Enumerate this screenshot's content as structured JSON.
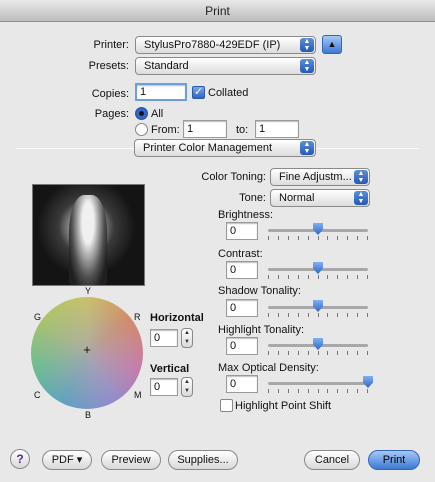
{
  "window": {
    "title": "Print"
  },
  "printer": {
    "label": "Printer:",
    "value": "StylusPro7880-429EDF (IP)"
  },
  "presets": {
    "label": "Presets:",
    "value": "Standard"
  },
  "copies": {
    "label": "Copies:",
    "value": "1",
    "collated_label": "Collated",
    "collated": true
  },
  "pages": {
    "label": "Pages:",
    "all_label": "All",
    "from_label": "From:",
    "to_label": "to:",
    "from_value": "1",
    "to_value": "1"
  },
  "section": {
    "value": "Printer Color Management"
  },
  "color_toning": {
    "label": "Color Toning:",
    "value": "Fine Adjustm..."
  },
  "tone": {
    "label": "Tone:",
    "value": "Normal"
  },
  "brightness": {
    "label": "Brightness:",
    "value": "0",
    "level": 0.5
  },
  "contrast": {
    "label": "Contrast:",
    "value": "0",
    "level": 0.5
  },
  "shadow": {
    "label": "Shadow Tonality:",
    "value": "0",
    "level": 0.5
  },
  "highlight": {
    "label": "Highlight Tonality:",
    "value": "0",
    "level": 0.5
  },
  "density": {
    "label": "Max Optical Density:",
    "value": "0",
    "level": 1.0
  },
  "highlight_shift": {
    "label": "Highlight Point Shift",
    "checked": false
  },
  "wheel": {
    "y": "Y",
    "r": "R",
    "m": "M",
    "b": "B",
    "c": "C",
    "g": "G",
    "crosshair": "+"
  },
  "horizontal": {
    "label": "Horizontal",
    "value": "0"
  },
  "vertical": {
    "label": "Vertical",
    "value": "0"
  },
  "footer": {
    "help": "?",
    "pdf": "PDF ▾",
    "preview": "Preview",
    "supplies": "Supplies...",
    "cancel": "Cancel",
    "print": "Print"
  },
  "colors": {
    "accent": "#2e64c5",
    "default_button": "#3d79d5"
  }
}
